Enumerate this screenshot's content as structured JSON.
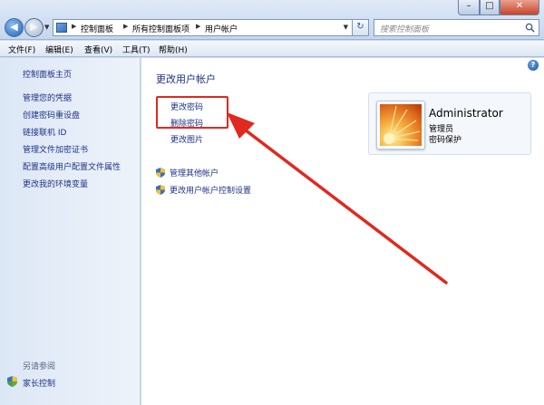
{
  "window": {
    "controls": {
      "minimize": "–",
      "maximize": "□",
      "close": "✕"
    }
  },
  "navigation": {
    "back_icon": "back-arrow-icon",
    "forward_icon": "forward-arrow-icon",
    "breadcrumbs": [
      "控制面板",
      "所有控制面板项",
      "用户帐户"
    ],
    "search_placeholder": "搜索控制面板"
  },
  "menubar": {
    "items": [
      "文件(F)",
      "编辑(E)",
      "查看(V)",
      "工具(T)",
      "帮助(H)"
    ]
  },
  "sidebar": {
    "home": "控制面板主页",
    "links": [
      "管理您的凭据",
      "创建密码重设盘",
      "链接联机 ID",
      "管理文件加密证书",
      "配置高级用户配置文件属性",
      "更改我的环境变量"
    ],
    "see_also_label": "另请参阅",
    "see_also_links": [
      "家长控制"
    ]
  },
  "main": {
    "title": "更改用户帐户",
    "links": [
      "更改密码",
      "删除密码",
      "更改图片"
    ],
    "shield_links": [
      "管理其他帐户",
      "更改用户帐户控制设置"
    ]
  },
  "user": {
    "name": "Administrator",
    "role": "管理员",
    "status": "密码保护"
  },
  "colors": {
    "link": "#1e3287",
    "highlight": "#e0291f",
    "arrow": "#e0291f"
  }
}
